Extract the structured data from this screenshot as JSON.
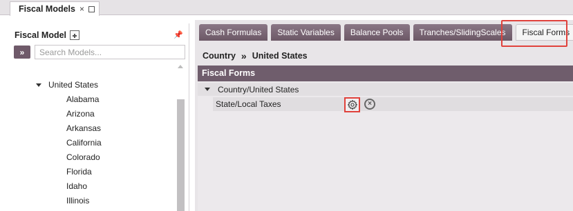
{
  "window": {
    "tab_title": "Fiscal Models",
    "close_glyph": "×"
  },
  "left_panel": {
    "title": "Fiscal Model",
    "expand_glyph": "»",
    "search_placeholder": "Search Models...",
    "search_value": "",
    "tree": {
      "root_label": "United States",
      "children": [
        "Alabama",
        "Arizona",
        "Arkansas",
        "California",
        "Colorado",
        "Florida",
        "Idaho",
        "Illinois"
      ]
    },
    "icons": {
      "add": "add-square-icon",
      "pin": "pin-icon",
      "expand": "double-chevron-right-icon"
    }
  },
  "right_panel": {
    "tabs": [
      {
        "label": "Cash Formulas",
        "active": false
      },
      {
        "label": "Static Variables",
        "active": false
      },
      {
        "label": "Balance Pools",
        "active": false
      },
      {
        "label": "Tranches/SlidingScales",
        "active": false
      },
      {
        "label": "Fiscal Forms",
        "active": true
      }
    ],
    "breadcrumb": {
      "root": "Country",
      "separator": "»",
      "current": "United States"
    },
    "section_title": "Fiscal Forms",
    "group_label": "Country/United States",
    "items": [
      {
        "label": "State/Local Taxes"
      }
    ],
    "remove_glyph": "×"
  },
  "colors": {
    "accent": "#6f5d6c",
    "tab_bg": "#7b6777",
    "highlight": "#e0413b",
    "panel_bg": "#e8e5e8"
  }
}
